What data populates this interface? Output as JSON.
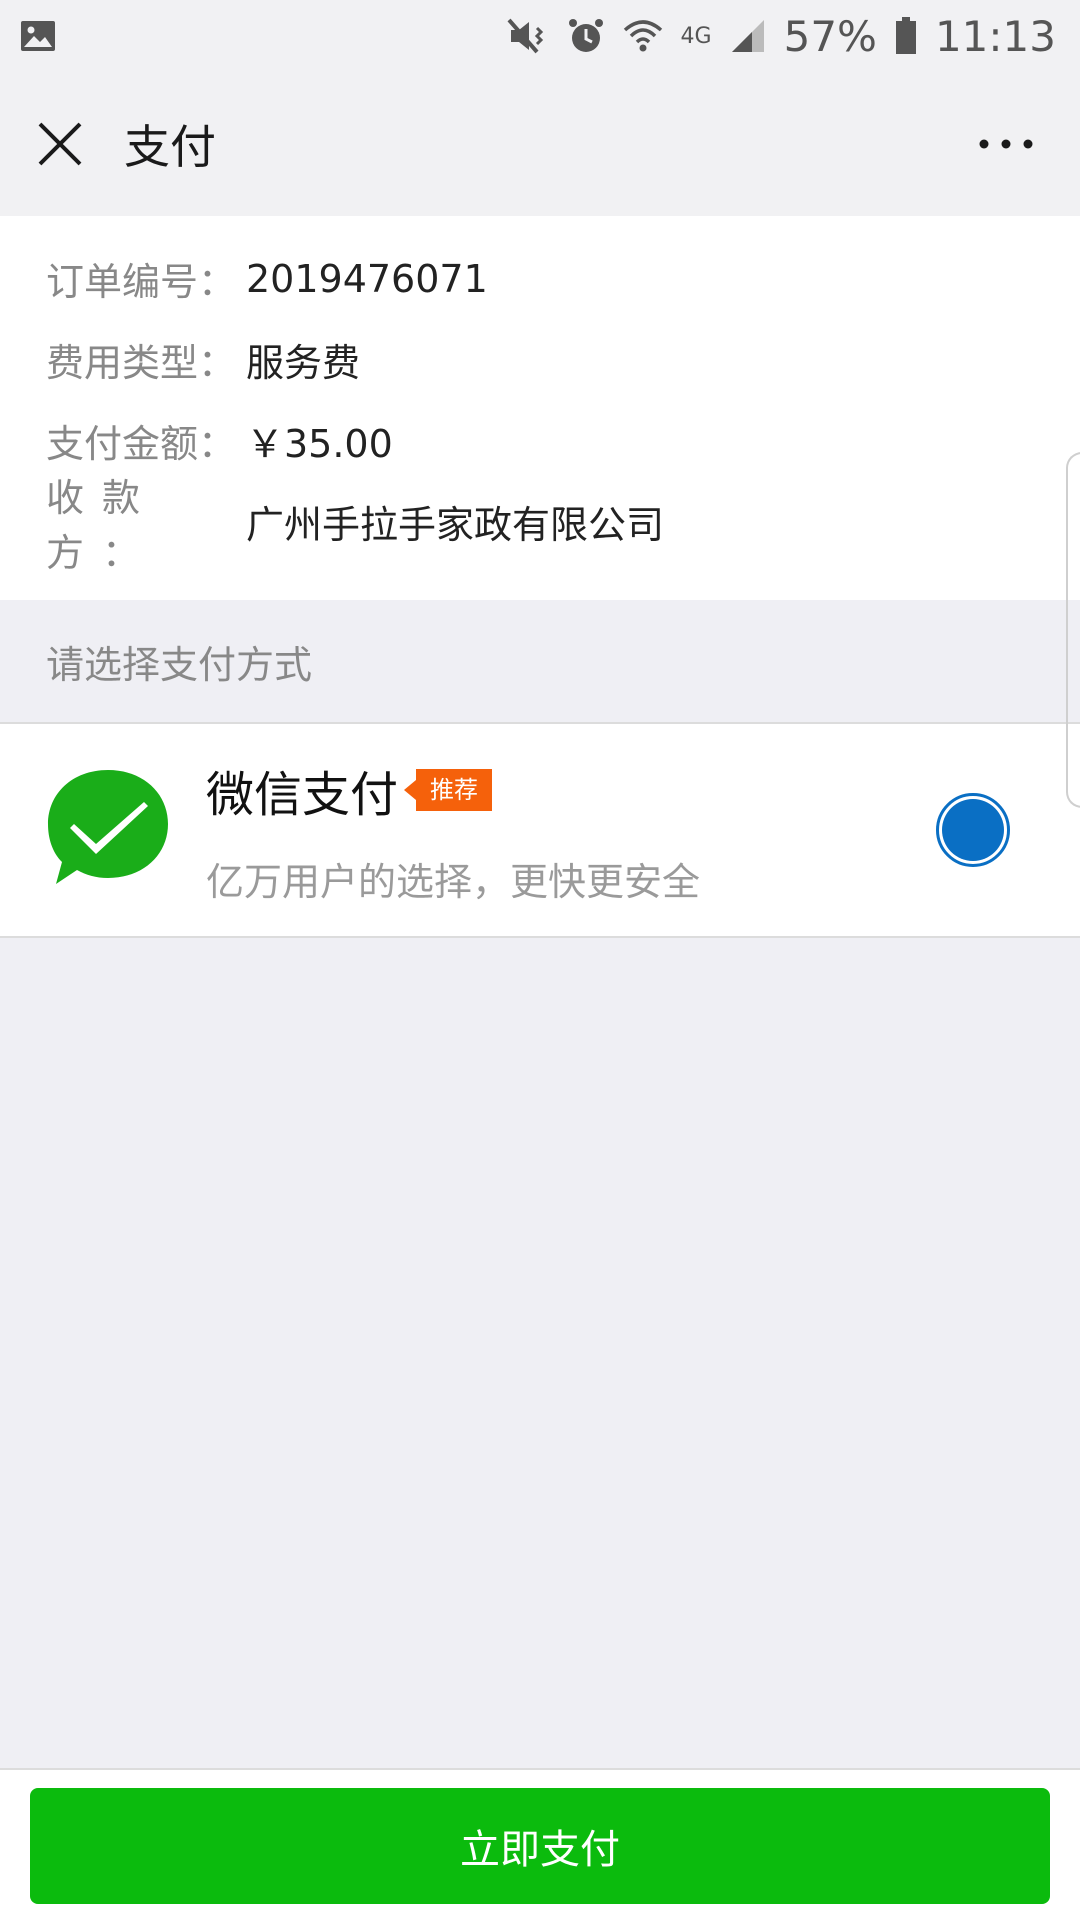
{
  "status_bar": {
    "battery": "57%",
    "time": "11:13",
    "network": "4G",
    "icons": [
      "image-icon",
      "mute-vibrate-icon",
      "alarm-icon",
      "wifi-icon",
      "signal-icon",
      "battery-icon"
    ]
  },
  "nav": {
    "title": "支付",
    "close_icon": "close-icon",
    "more_icon": "more-icon"
  },
  "order": {
    "rows": [
      {
        "label": "订单编号：",
        "value": "2019476071"
      },
      {
        "label": "费用类型：",
        "value": "服务费"
      },
      {
        "label": "支付金额：",
        "value": "￥35.00"
      },
      {
        "label": "收款方：",
        "value": "广州手拉手家政有限公司"
      }
    ]
  },
  "payment": {
    "section_title": "请选择支付方式",
    "method": {
      "name": "微信支付",
      "badge": "推荐",
      "description": "亿万用户的选择，更快更安全",
      "selected": true,
      "icon": "wechat-pay-icon"
    }
  },
  "footer": {
    "pay_button": "立即支付"
  },
  "colors": {
    "primary_green": "#0bbb0d",
    "wechat_green": "#1aad19",
    "badge_orange": "#f5610b",
    "radio_blue": "#0a6fc4"
  }
}
